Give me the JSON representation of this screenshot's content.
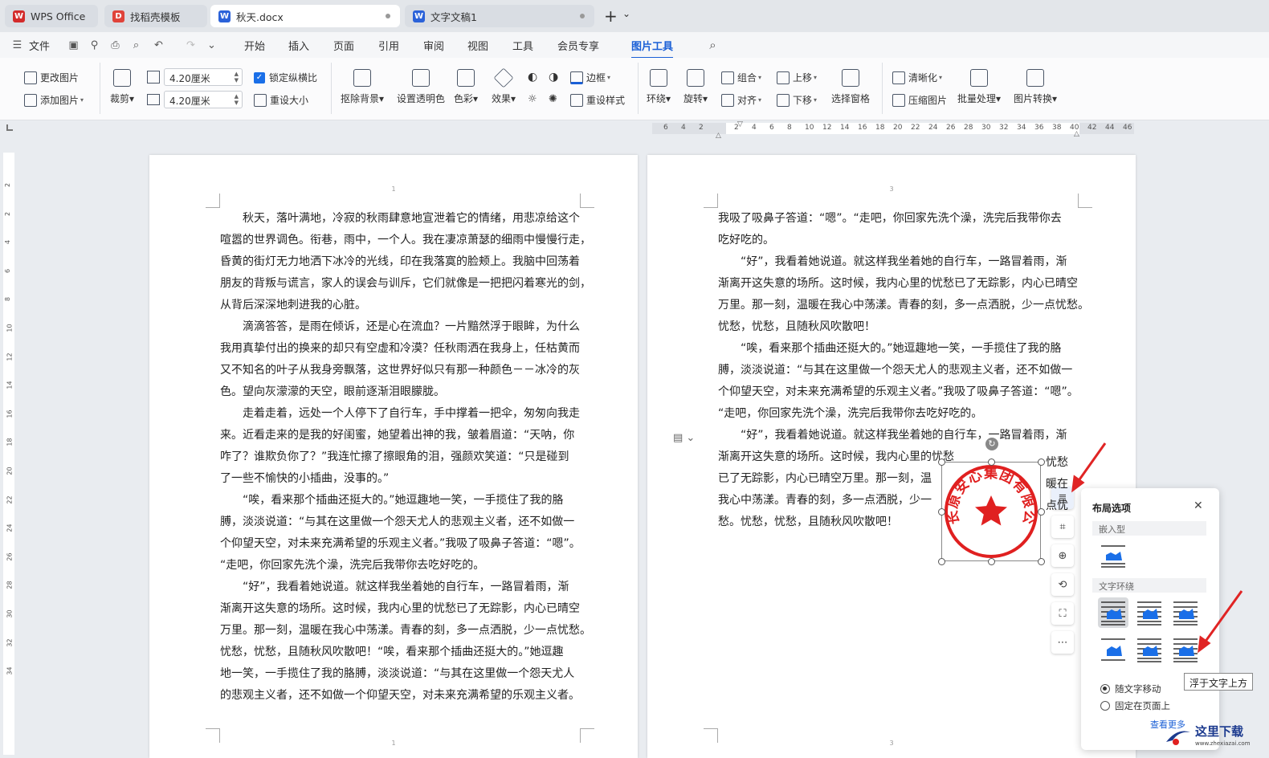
{
  "tabs": [
    {
      "label": "WPS Office",
      "icon": "wps-logo-icon"
    },
    {
      "label": "找稻壳模板",
      "icon": "docer-icon"
    },
    {
      "label": "秋天.docx",
      "icon": "word-doc-icon"
    },
    {
      "label": "文字文稿1",
      "icon": "word-doc-icon"
    }
  ],
  "tabbar": {
    "new_tab": "+",
    "more": "⌄"
  },
  "menu": {
    "file": "文件",
    "items": [
      "开始",
      "插入",
      "页面",
      "引用",
      "审阅",
      "视图",
      "工具",
      "会员专享",
      "图片工具"
    ],
    "active": "图片工具"
  },
  "ribbon": {
    "change_pic": "更改图片",
    "add_pic": "添加图片",
    "crop": "裁剪",
    "width": "4.20厘米",
    "height": "4.20厘米",
    "lock_ratio": "锁定纵横比",
    "reset_size": "重设大小",
    "remove_bg": "抠除背景",
    "set_transparent": "设置透明色",
    "color": "色彩",
    "effect": "效果",
    "border": "边框",
    "reset_style": "重设样式",
    "wrap": "环绕",
    "rotate": "旋转",
    "group": "组合",
    "align": "对齐",
    "move_up": "上移",
    "move_down": "下移",
    "selection_pane": "选择窗格",
    "sharpen": "清晰化",
    "compress": "压缩图片",
    "batch": "批量处理",
    "convert": "图片转换"
  },
  "ruler_numbers": [
    "6",
    "4",
    "2",
    "2",
    "4",
    "6",
    "8",
    "10",
    "12",
    "14",
    "16",
    "18",
    "20",
    "22",
    "24",
    "26",
    "28",
    "30",
    "32",
    "34",
    "36",
    "38",
    "40",
    "42",
    "44",
    "46"
  ],
  "vruler_numbers": [
    "2",
    "2",
    "4",
    "6",
    "8",
    "10",
    "12",
    "14",
    "16",
    "18",
    "20",
    "22",
    "24",
    "26",
    "28",
    "30",
    "32",
    "34"
  ],
  "page_left": {
    "number_top": "1",
    "number_bottom": "1",
    "lines": [
      "　　秋天，落叶满地，冷寂的秋雨肆意地宣泄着它的情绪，用悲凉给这个",
      "喧嚣的世界调色。衔巷，雨中，一个人。我在凄凉萧瑟的细雨中慢慢行走，",
      "昏黄的街灯无力地洒下冰冷的光线，印在我落寞的脸颊上。我脑中回荡着",
      "朋友的背叛与谎言，家人的误会与训斥，它们就像是一把把闪着寒光的剑，",
      "从背后深深地刺进我的心脏。",
      "　　滴滴答答，是雨在倾诉，还是心在流血？一片黯然浮于眼眸，为什么",
      "我用真挚付出的换来的却只有空虚和冷漠？任秋雨洒在我身上，任枯黄而",
      "又不知名的叶子从我身旁飘落，这世界好似只有那一种颜色－－冰冷的灰",
      "色。望向灰濛濛的天空，眼前逐渐泪眼朦胧。",
      "　　走着走着，远处一个人停下了自行车，手中撑着一把伞，匆匆向我走",
      "来。近看走来的是我的好闺蜜，她望着出神的我，皱着眉道：“天呐，你",
      "咋了？谁欺负你了？”我连忙擦了擦眼角的泪，强颜欢笑道：“只是碰到",
      "了一些不愉快的小插曲，没事的。”",
      "　　“唉，看来那个插曲还挺大的。”她逗趣地一笑，一手揽住了我的胳",
      "膊，淡淡说道：“与其在这里做一个怨天尤人的悲观主义者，还不如做一",
      "个仰望天空，对未来充满希望的乐观主义者。”我吸了吸鼻子答道：“嗯”。",
      "“走吧，你回家先洗个澡，洗完后我带你去吃好吃的。",
      "　　“好”，我看着她说道。就这样我坐着她的自行车，一路冒着雨，渐",
      "渐离开这失意的场所。这时候，我内心里的忧愁已了无踪影，内心已晴空",
      "万里。那一刻，温暖在我心中荡漾。青春的刻，多一点洒脱，少一点忧愁。",
      "忧愁，忧愁，且随秋风吹散吧！“唉，看来那个插曲还挺大的。”她逗趣",
      "地一笑，一手揽住了我的胳膊，淡淡说道：“与其在这里做一个怨天尤人",
      "的悲观主义者，还不如做一个仰望天空，对未来充满希望的乐观主义者。"
    ]
  },
  "page_right": {
    "number_top": "3",
    "number_bottom": "3",
    "lines": [
      "我吸了吸鼻子答道：“嗯”。“走吧，你回家先洗个澡，洗完后我带你去",
      "吃好吃的。",
      "　　“好”，我看着她说道。就这样我坐着她的自行车，一路冒着雨，渐",
      "渐离开这失意的场所。这时候，我内心里的忧愁已了无踪影，内心已晴空",
      "万里。那一刻，温暖在我心中荡漾。青春的刻，多一点洒脱，少一点忧愁。",
      "忧愁，忧愁，且随秋风吹散吧！",
      "　　“唉，看来那个插曲还挺大的。”她逗趣地一笑，一手揽住了我的胳",
      "膊，淡淡说道：“与其在这里做一个怨天尤人的悲观主义者，还不如做一",
      "个仰望天空，对未来充满希望的乐观主义者。”我吸了吸鼻子答道：“嗯”。",
      "“走吧，你回家先洗个澡，洗完后我带你去吃好吃的。",
      "　　“好”，我看着她说道。就这样我坐着她的自行车，一路冒着雨，渐",
      "渐离开这失意的场所。这时候，我内心里的忧愁",
      "已了无踪影，内心已晴空万里。那一刻，温",
      "我心中荡漾。青春的刻，多一点洒脱，少一",
      "愁。忧愁，忧愁，且随秋风吹散吧！"
    ],
    "wrap_right": [
      "忧愁",
      "暖在",
      "点忧"
    ]
  },
  "stamp": {
    "arc_text": "长原安心集团有限公司",
    "color": "#e02020"
  },
  "side_toolbar": [
    "layout-options-icon",
    "crop-icon",
    "zoom-icon",
    "rotate-icon",
    "fullscreen-icon",
    "more-icon"
  ],
  "layout_panel": {
    "title": "布局选项",
    "close": "✕",
    "section_inline": "嵌入型",
    "section_wrap": "文字环绕",
    "radio_move": "随文字移动",
    "radio_fixed": "固定在页面上",
    "selected_radio": "随文字移动",
    "more_link": "查看更多"
  },
  "tooltip": "浮于文字上方",
  "watermark": {
    "text": "这里下载",
    "url": "www.zhexiazai.com"
  },
  "colors": {
    "accent": "#1a5fd6",
    "stamp_red": "#e02020",
    "arrow_red": "#e02424"
  }
}
